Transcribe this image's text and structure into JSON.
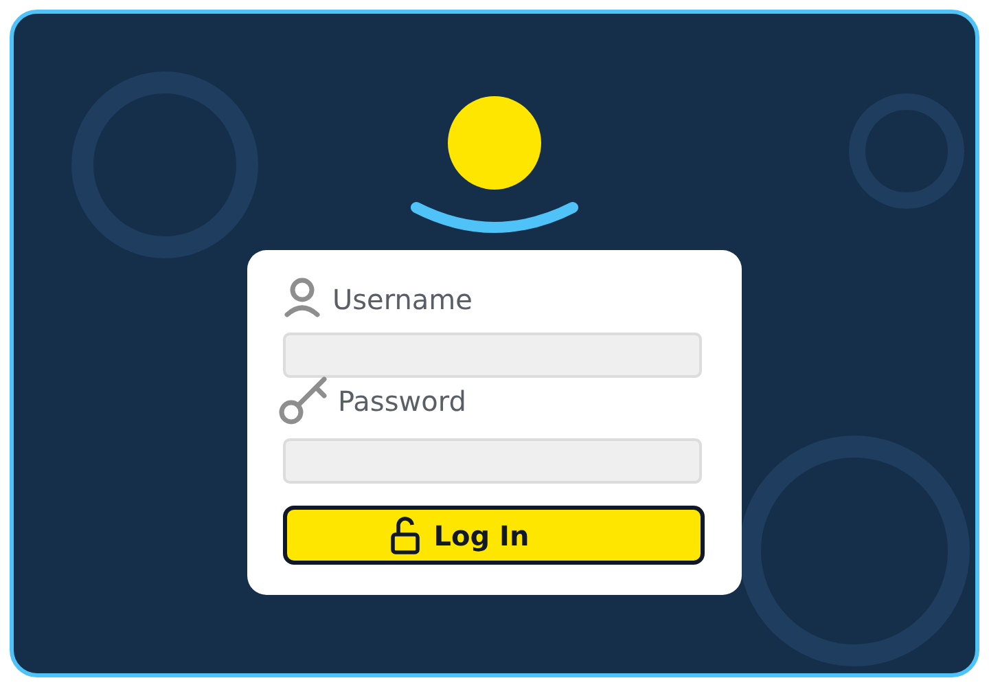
{
  "login_form": {
    "fields": [
      {
        "kind": "username",
        "label": "Username"
      },
      {
        "kind": "password",
        "label": "Password"
      }
    ],
    "button": "Log In"
  }
}
